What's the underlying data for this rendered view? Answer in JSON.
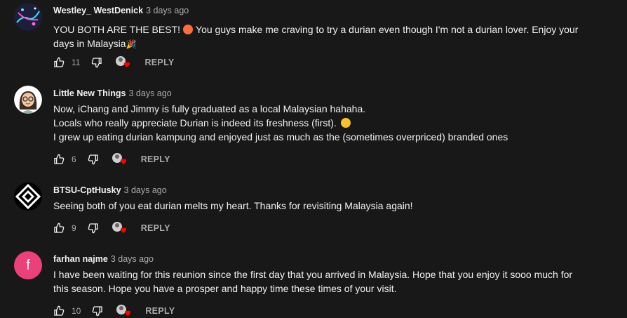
{
  "comments": [
    {
      "author": "Westley_ WestDenick",
      "time": "3 days ago",
      "lines": [
        "YOU BOTH ARE THE BEST!",
        "You guys make me craving to try a durian even though I'm not a durian lover. Enjoy your",
        "days in Malaysia"
      ],
      "likes": "11",
      "reply": "REPLY",
      "avatar_icon": "galaxy-avatar-icon"
    },
    {
      "author": "Little New Things",
      "time": "3 days ago",
      "lines": [
        "Now, iChang and Jimmy is fully graduated as a local Malaysian hahaha.",
        "Locals who really appreciate Durian is indeed its freshness (first).",
        "I grew up eating durian kampung and enjoyed just as much as the (sometimes overpriced) branded ones"
      ],
      "likes": "6",
      "reply": "REPLY",
      "avatar_icon": "cartoon-woman-avatar-icon"
    },
    {
      "author": "BTSU-CptHusky",
      "time": "3 days ago",
      "lines": [
        "Seeing both of you eat durian melts my heart. Thanks for revisiting Malaysia again!"
      ],
      "likes": "9",
      "reply": "REPLY",
      "avatar_icon": "diamond-logo-avatar-icon"
    },
    {
      "author": "farhan najme",
      "time": "3 days ago",
      "lines": [
        "I have been waiting for this reunion since the first day that you arrived in Malaysia. Hope that you enjoy it sooo much for",
        "this season. Hope you have a prosper and happy time these times of your visit."
      ],
      "likes": "10",
      "reply": "REPLY",
      "avatar_letter": "f",
      "avatar_color": "#ec407a"
    }
  ],
  "colors": {
    "background": "#181818",
    "text": "#f1f1f1",
    "muted": "#aaaaaa",
    "heart": "#ff0000"
  }
}
